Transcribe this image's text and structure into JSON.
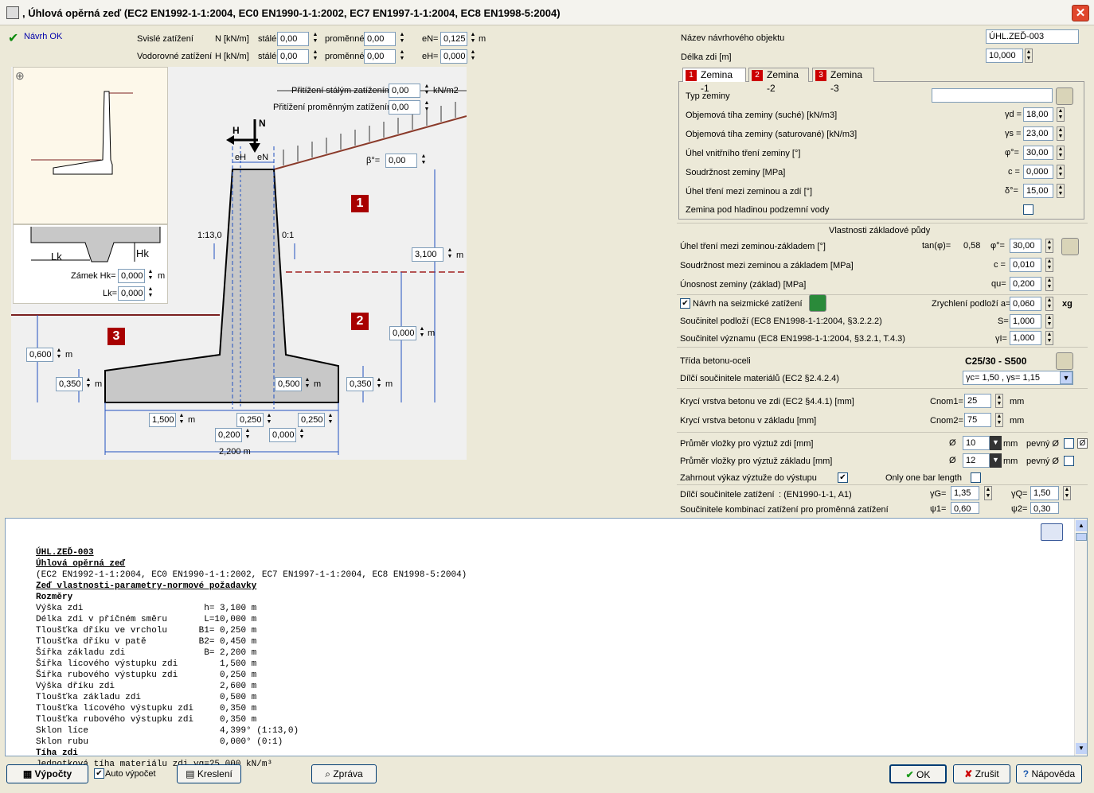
{
  "window": {
    "title": ", Úhlová opěrná zeď (EC2 EN1992-1-1:2004, EC0 EN1990-1-1:2002, EC7 EN1997-1-1:2004, EC8 EN1998-5:2004)"
  },
  "status": {
    "ok_label": "Návrh OK"
  },
  "loads": {
    "vertical_label": "Svislé zatížení",
    "vertical_unit": "N [kN/m]",
    "horizontal_label": "Vodorovné zatížení",
    "horizontal_unit": "H [kN/m]",
    "permanent_label": "stálé",
    "variable_label": "proměnné",
    "n_perm": "0,00",
    "n_var": "0,00",
    "h_perm": "0,00",
    "h_var": "0,00",
    "en_label": "eN=",
    "en_value": "0,125",
    "en_unit": "m",
    "eh_label": "eH=",
    "eh_value": "0,000"
  },
  "surcharge": {
    "perm_label": "Přitížení stálým zatížením",
    "perm_value": "0,00",
    "unit": "kN/m2",
    "var_label": "Přitížení proměnným zatížením",
    "var_value": "0,00"
  },
  "drawing": {
    "beta_label": "β°=",
    "beta_value": "0,00",
    "h_label": "H",
    "n_label": "N",
    "eh_sym": "eH",
    "en_sym": "eN",
    "slope_front": "1:13,0",
    "slope_back": "0:1",
    "height_value": "3,100",
    "height_unit": "m",
    "water_value": "0,000",
    "water_unit": "m",
    "front_soil_value": "0,600",
    "front_soil_unit": "m",
    "toe_thick": "0,350",
    "heel_thick": "0,350",
    "base_thick": "0,500",
    "m": "m",
    "toe_len": "1,500",
    "b1": "0,250",
    "heel_len": "0,250",
    "b_front": "0,200",
    "b_back": "0,000",
    "total_width": "2,200 m",
    "zone1": "1",
    "zone2": "2",
    "zone3": "3",
    "key_label": "Zámek Hk=",
    "key_value": "0,000",
    "key_unit": "m",
    "lk_label": "Lk=",
    "lk_value": "0,000",
    "lk_sym": "Lk",
    "hk_sym": "Hk"
  },
  "object": {
    "name_label": "Název návrhového objektu",
    "name_value": "ÚHL.ZEĎ-003",
    "length_label": "Délka zdi [m]",
    "length_value": "10,000"
  },
  "tabs": [
    {
      "num": "1",
      "label": "Zemina -1"
    },
    {
      "num": "2",
      "label": "Zemina -2"
    },
    {
      "num": "3",
      "label": "Zemina -3"
    }
  ],
  "soil": {
    "type_label": "Typ zeminy",
    "type_value": "",
    "gd_label": "Objemová tíha zeminy (suché) [kN/m3]",
    "gd_sym": "γd =",
    "gd_value": "18,00",
    "gs_label": "Objemová tíha zeminy (saturované) [kN/m3]",
    "gs_sym": "γs =",
    "gs_value": "23,00",
    "phi_label": "Úhel vnitřního tření zeminy [°]",
    "phi_sym": "φ°=",
    "phi_value": "30,00",
    "c_label": "Soudržnost zeminy [MPa]",
    "c_sym": "c =",
    "c_value": "0,000",
    "delta_label": "Úhel tření mezi zeminou a zdí [°]",
    "delta_sym": "δ°=",
    "delta_value": "15,00",
    "water_label": "Zemina pod hladinou podzemní vody"
  },
  "foundation": {
    "heading": "Vlastnosti základové půdy",
    "phi_label": "Úhel tření mezi zeminou-základem [°]",
    "tan_label": "tan(φ)=",
    "tan_value": "0,58",
    "phi_sym": "φ°=",
    "phi_value": "30,00",
    "c_label": "Soudržnost mezi zeminou a základem [MPa]",
    "c_sym": "c =",
    "c_value": "0,010",
    "qu_label": "Únosnost zeminy (základ) [MPa]",
    "qu_sym": "qu=",
    "qu_value": "0,200"
  },
  "seismic": {
    "label": "Návrh na seizmické zatížení",
    "acc_label": "Zrychlení podloží a=",
    "acc_value": "0,060",
    "acc_unit": "xg",
    "s_label": "Součinitel podloží (EC8 EN1998-1-1:2004, §3.2.2.2)",
    "s_sym": "S=",
    "s_value": "1,000",
    "gi_label": "Součinitel významu (EC8 EN1998-1-1:2004, §3.2.1, T.4.3)",
    "gi_sym": "γI=",
    "gi_value": "1,000"
  },
  "concrete": {
    "class_label": "Třída betonu-oceli",
    "class_value": "C25/30 - S500",
    "factors_label": "Dílčí součinitele materiálů (EC2 §2.4.2.4)",
    "factors_value": "γc= 1,50 , γs= 1,15",
    "cnom1_label": "Krycí vrstva betonu ve zdi (EC2 §4.4.1) [mm]",
    "cnom1_sym": "Cnom1=",
    "cnom1_value": "25",
    "cnom2_label": "Krycí vrstva betonu v základu  [mm]",
    "cnom2_sym": "Cnom2=",
    "cnom2_value": "75",
    "mm": "mm"
  },
  "rebar": {
    "wall_label": "Průměr vložky pro výztuž zdi [mm]",
    "wall_value": "10",
    "base_label": "Průměr vložky pro výztuž základu [mm]",
    "base_value": "12",
    "dia_sym": "Ø",
    "fixed_label": "pevný Ø",
    "mm": "mm",
    "include_label": "Zahrnout výkaz výztuže do výstupu",
    "one_bar_label": "Only one bar length"
  },
  "factors": {
    "load_label": "Dílčí součinitele zatížení",
    "load_ref": ": (EN1990-1-1, A1)",
    "gg_sym": "γG=",
    "gg_value": "1,35",
    "gq_sym": "γQ=",
    "gq_value": "1,50",
    "comb_label": "Součinitele kombinací zatížení pro proměnná zatížení",
    "psi1_sym": "ψ1=",
    "psi1_value": "0,60",
    "psi2_sym": "ψ2=",
    "psi2_value": "0,30"
  },
  "report": {
    "lines": [
      "ÚHL.ZEĎ-003",
      "Úhlová opěrná zeď",
      "(EC2 EN1992-1-1:2004, EC0 EN1990-1-1:2002, EC7 EN1997-1-1:2004, EC8 EN1998-5:2004)",
      "Zeď vlastnosti-parametry-normové požadavky",
      "Rozměry",
      "Výška zdi                       h= 3,100 m",
      "Délka zdi v příčném směru       L=10,000 m",
      "Tloušťka dříku ve vrcholu      B1= 0,250 m",
      "Tloušťka dříku v patě          B2= 0,450 m",
      "Šířka základu zdi               B= 2,200 m",
      "Šířka lícového výstupku zdi        1,500 m",
      "Šířka rubového výstupku zdi        0,250 m",
      "Výška dříku zdi                    2,600 m",
      "Tloušťka základu zdi               0,500 m",
      "Tloušťka lícového výstupku zdi     0,350 m",
      "Tloušťka rubového výstupku zdi     0,350 m",
      "Sklon líce                         4,399° (1:13,0)",
      "Sklon rubu                         0,000° (0:1)",
      "Tíha zdi",
      "Jednotková tíha materiálu zdi γg=25,000 kN/m³"
    ]
  },
  "buttons": {
    "calc": "Výpočty",
    "auto": "Auto výpočet",
    "draw": "Kreslení",
    "report": "Zpráva",
    "ok": "OK",
    "cancel": "Zrušit",
    "help": "Nápověda"
  }
}
